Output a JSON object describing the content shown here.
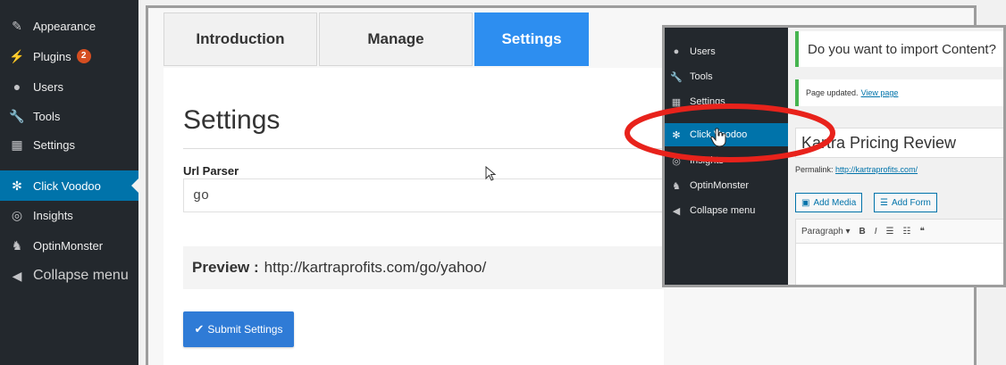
{
  "sidebar": {
    "items": [
      {
        "label": "Appearance",
        "icon": "paintbrush-icon"
      },
      {
        "label": "Plugins",
        "icon": "plugins-icon",
        "badge": "2"
      },
      {
        "label": "Users",
        "icon": "users-icon"
      },
      {
        "label": "Tools",
        "icon": "wrench-icon"
      },
      {
        "label": "Settings",
        "icon": "settings-icon"
      },
      {
        "label": "Click Voodoo",
        "icon": "gear-icon",
        "active": true
      },
      {
        "label": "Insights",
        "icon": "insights-icon"
      },
      {
        "label": "OptinMonster",
        "icon": "optinmonster-icon"
      },
      {
        "label": "Collapse menu",
        "icon": "collapse-icon"
      }
    ]
  },
  "tabs": [
    {
      "label": "Introduction"
    },
    {
      "label": "Manage"
    },
    {
      "label": "Settings",
      "active": true
    }
  ],
  "settings": {
    "title": "Settings",
    "url_parser_label": "Url Parser",
    "url_parser_value": "go",
    "preview_label": "Preview :",
    "preview_value": "http://kartraprofits.com/go/yahoo/",
    "submit_label": "Submit Settings"
  },
  "inset": {
    "sidebar": [
      {
        "label": "Users"
      },
      {
        "label": "Tools"
      },
      {
        "label": "Settings"
      },
      {
        "label": "Click Voodoo",
        "active": true
      },
      {
        "label": "Insights"
      },
      {
        "label": "OptinMonster"
      },
      {
        "label": "Collapse menu"
      }
    ],
    "notice_import": "Do you want to import Content?",
    "notice_updated": "Page updated.",
    "notice_view_link": "View page",
    "post_title": "Kartra Pricing Review",
    "permalink_label": "Permalink:",
    "permalink_url": "http://kartraprofits.com/",
    "add_media": "Add Media",
    "add_form": "Add Form",
    "format_select": "Paragraph"
  },
  "colors": {
    "sidebar_bg": "#23282d",
    "active_blue": "#0073aa",
    "tab_active": "#2d8ef0",
    "highlight_red": "#e8221b"
  }
}
